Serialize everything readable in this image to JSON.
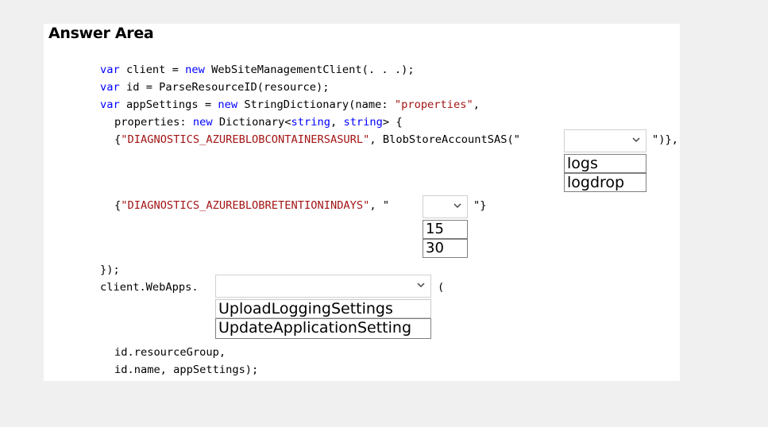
{
  "title": "Answer Area",
  "code": {
    "l1_kw1": "var",
    "l1_a": " client = ",
    "l1_kw2": "new",
    "l1_b": " WebSiteManagementClient(. . .);",
    "l2_kw1": "var",
    "l2_a": " id = ParseResourceID(resource);",
    "l3_kw1": "var",
    "l3_a": " appSettings = ",
    "l3_kw2": "new",
    "l3_b": " StringDictionary(name: ",
    "l3_str": "\"properties\"",
    "l3_c": ",",
    "l4_a": "properties: ",
    "l4_kw1": "new",
    "l4_b": " Dictionary<",
    "l4_kw2": "string",
    "l4_c": ", ",
    "l4_kw3": "string",
    "l4_d": "> {",
    "l5_a": "{",
    "l5_str": "\"DIAGNOSTICS_AZUREBLOBCONTAINERSASURL\"",
    "l5_b": ", BlobStoreAccountSAS(\"",
    "l5_end": "\")},",
    "l6_a": "{",
    "l6_str": "\"DIAGNOSTICS_AZUREBLOBRETENTIONINDAYS\"",
    "l6_b": ", \"",
    "l6_end": "\"}",
    "l7": "});",
    "l8": "client.WebApps.",
    "l8_end": "(",
    "l9": "id.resourceGroup,",
    "l10": "id.name, appSettings);"
  },
  "dropdowns": {
    "container": {
      "selected": "",
      "options": [
        "logs",
        "logdrop"
      ]
    },
    "retention": {
      "selected": "",
      "options": [
        "15",
        "30"
      ]
    },
    "method": {
      "selected": "",
      "options": [
        "UploadLoggingSettings",
        "UpdateApplicationSetting"
      ]
    }
  },
  "icons": {
    "chevron": "chevron-down-icon"
  },
  "colors": {
    "keyword": "#0000ff",
    "string": "#a31515",
    "background": "#f0f0f0",
    "panel": "#ffffff"
  }
}
